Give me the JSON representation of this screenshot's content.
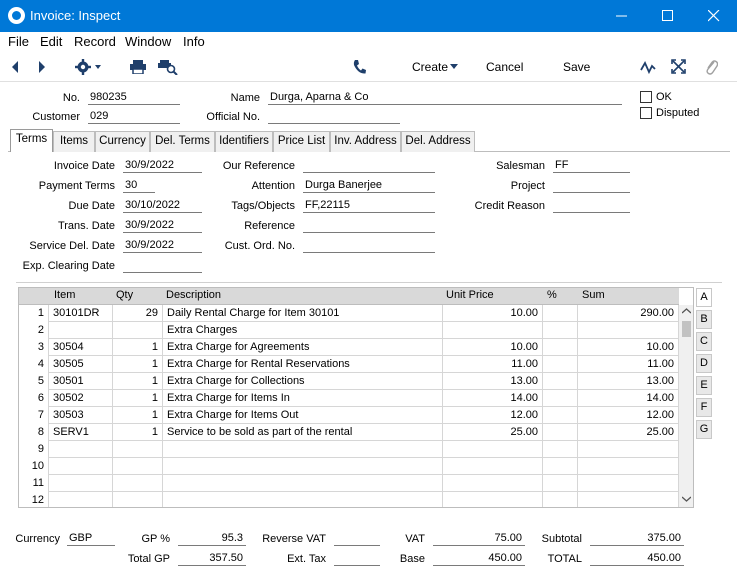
{
  "window": {
    "title": "Invoice: Inspect"
  },
  "menu": [
    "File",
    "Edit",
    "Record",
    "Window",
    "Info"
  ],
  "toolbar": {
    "create": "Create",
    "cancel": "Cancel",
    "save": "Save"
  },
  "header": {
    "no_label": "No.",
    "no": "980235",
    "name_label": "Name",
    "name": "Durga, Aparna & Co",
    "customer_label": "Customer",
    "customer": "029",
    "official_label": "Official No.",
    "official": "",
    "ok_label": "OK",
    "disputed_label": "Disputed"
  },
  "tabs": [
    "Terms",
    "Items",
    "Currency",
    "Del. Terms",
    "Identifiers",
    "Price List",
    "Inv. Address",
    "Del. Address"
  ],
  "terms": {
    "invoice_date_label": "Invoice Date",
    "invoice_date": "30/9/2022",
    "payment_terms_label": "Payment Terms",
    "payment_terms": "30",
    "due_date_label": "Due Date",
    "due_date": "30/10/2022",
    "trans_date_label": "Trans. Date",
    "trans_date": "30/9/2022",
    "service_del_label": "Service Del. Date",
    "service_del": "30/9/2022",
    "exp_clearing_label": "Exp. Clearing Date",
    "exp_clearing": "",
    "our_ref_label": "Our Reference",
    "our_ref": "",
    "attention_label": "Attention",
    "attention": "Durga Banerjee",
    "tags_label": "Tags/Objects",
    "tags": "FF,22115",
    "reference_label": "Reference",
    "reference": "",
    "cust_ord_label": "Cust. Ord. No.",
    "cust_ord": "",
    "salesman_label": "Salesman",
    "salesman": "FF",
    "project_label": "Project",
    "project": "",
    "credit_reason_label": "Credit Reason",
    "credit_reason": ""
  },
  "grid": {
    "columns": [
      "Item",
      "Qty",
      "Description",
      "Unit Price",
      "%",
      "Sum"
    ],
    "rows": [
      {
        "n": "1",
        "item": "30101DR",
        "qty": "29",
        "desc": "Daily Rental Charge for Item 30101",
        "price": "10.00",
        "pct": "",
        "sum": "290.00"
      },
      {
        "n": "2",
        "item": "",
        "qty": "",
        "desc": "Extra Charges",
        "price": "",
        "pct": "",
        "sum": ""
      },
      {
        "n": "3",
        "item": "30504",
        "qty": "1",
        "desc": "Extra Charge for Agreements",
        "price": "10.00",
        "pct": "",
        "sum": "10.00"
      },
      {
        "n": "4",
        "item": "30505",
        "qty": "1",
        "desc": "Extra Charge for Rental Reservations",
        "price": "11.00",
        "pct": "",
        "sum": "11.00"
      },
      {
        "n": "5",
        "item": "30501",
        "qty": "1",
        "desc": "Extra Charge for Collections",
        "price": "13.00",
        "pct": "",
        "sum": "13.00"
      },
      {
        "n": "6",
        "item": "30502",
        "qty": "1",
        "desc": "Extra Charge for Items In",
        "price": "14.00",
        "pct": "",
        "sum": "14.00"
      },
      {
        "n": "7",
        "item": "30503",
        "qty": "1",
        "desc": "Extra Charge for Items Out",
        "price": "12.00",
        "pct": "",
        "sum": "12.00"
      },
      {
        "n": "8",
        "item": "SERV1",
        "qty": "1",
        "desc": "Service to be sold as part of the rental",
        "price": "25.00",
        "pct": "",
        "sum": "25.00"
      },
      {
        "n": "9",
        "item": "",
        "qty": "",
        "desc": "",
        "price": "",
        "pct": "",
        "sum": ""
      },
      {
        "n": "10",
        "item": "",
        "qty": "",
        "desc": "",
        "price": "",
        "pct": "",
        "sum": ""
      },
      {
        "n": "11",
        "item": "",
        "qty": "",
        "desc": "",
        "price": "",
        "pct": "",
        "sum": ""
      },
      {
        "n": "12",
        "item": "",
        "qty": "",
        "desc": "",
        "price": "",
        "pct": "",
        "sum": ""
      }
    ],
    "side_tabs": [
      "A",
      "B",
      "C",
      "D",
      "E",
      "F",
      "G"
    ]
  },
  "footer": {
    "currency_label": "Currency",
    "currency": "GBP",
    "gp_pct_label": "GP %",
    "gp_pct": "95.3",
    "total_gp_label": "Total GP",
    "total_gp": "357.50",
    "reverse_vat_label": "Reverse VAT",
    "reverse_vat": "",
    "ext_tax_label": "Ext. Tax",
    "ext_tax": "",
    "vat_label": "VAT",
    "vat": "75.00",
    "base_label": "Base",
    "base": "450.00",
    "subtotal_label": "Subtotal",
    "subtotal": "375.00",
    "total_label": "TOTAL",
    "total": "450.00"
  }
}
